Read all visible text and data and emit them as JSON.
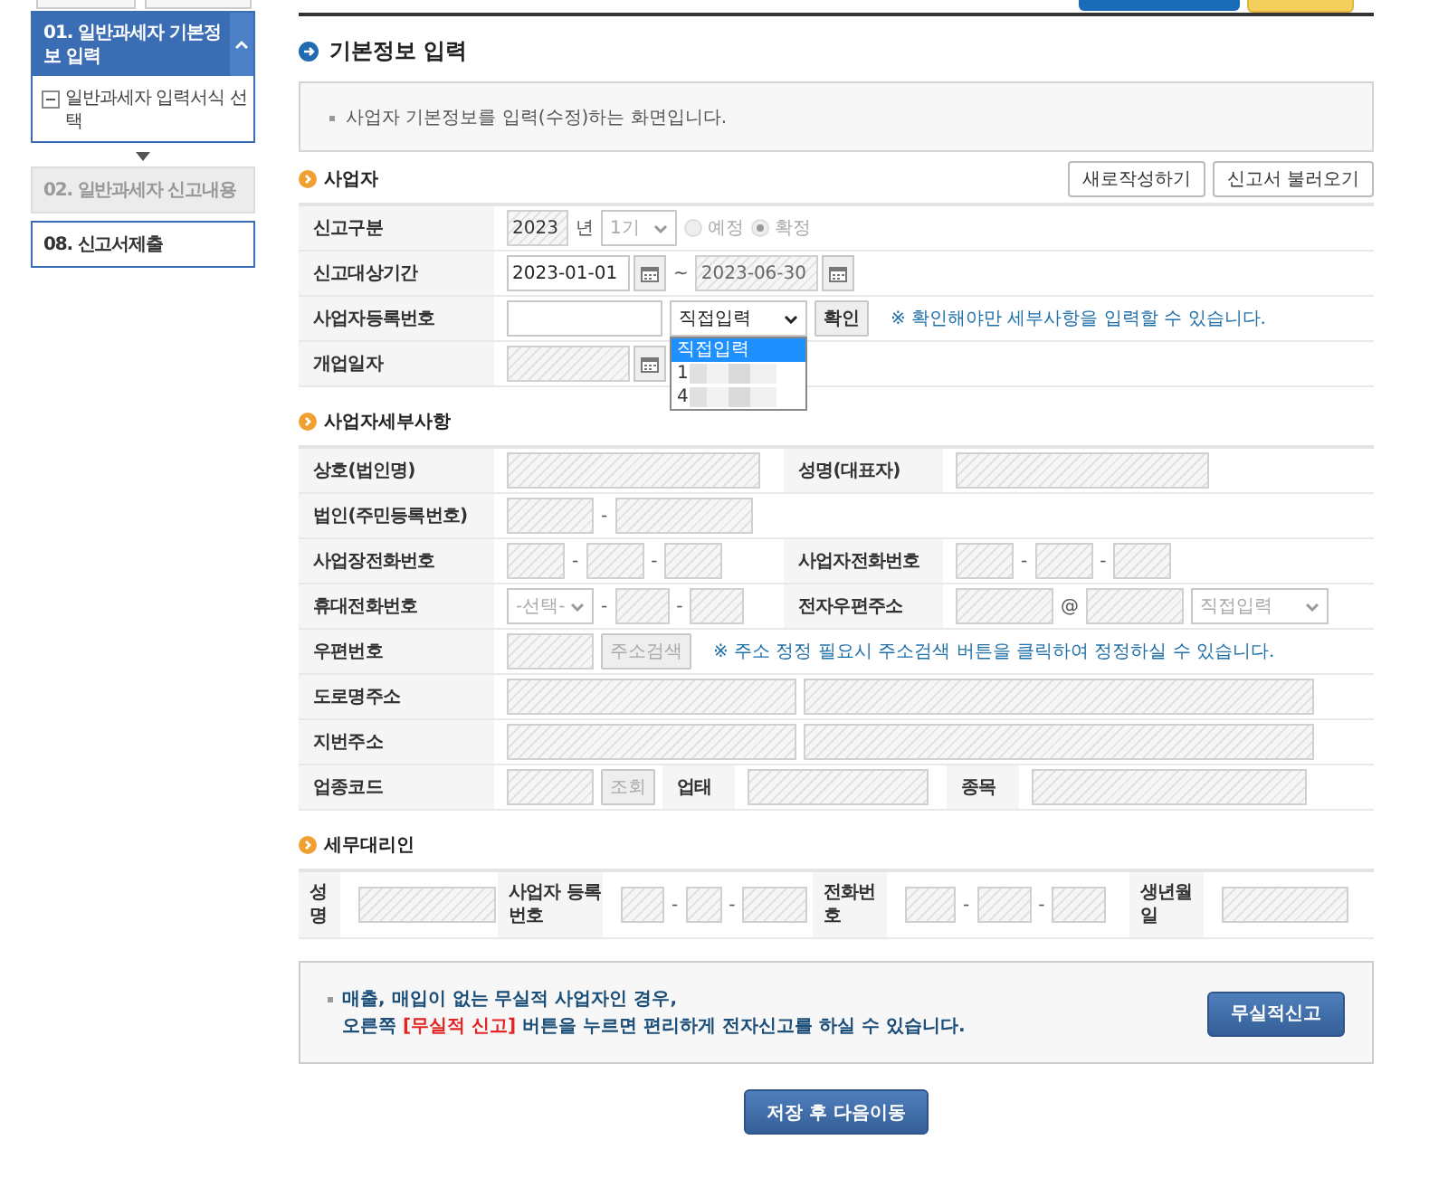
{
  "sidebar": {
    "steps": [
      {
        "label": "01. 일반과세자 기본정보 입력",
        "kind": "current",
        "expanded": true,
        "children": [
          {
            "label": "일반과세자 입력서식 선택"
          }
        ]
      },
      {
        "label": "02. 일반과세자 신고내용",
        "kind": "disabled"
      },
      {
        "label": "08. 신고서제출",
        "kind": "enabled"
      }
    ]
  },
  "page_title": "기본정보 입력",
  "info": "사업자 기본정보를 입력(수정)하는 화면입니다.",
  "sections": [
    {
      "title": "사업자",
      "buttons": [
        "새로작성하기",
        "신고서 불러오기"
      ],
      "rows": [
        {
          "cells": [
            {
              "kind": "label",
              "text": "신고구분"
            },
            {
              "kind": "value",
              "controls": [
                {
                  "kind": "input",
                  "value": "2023",
                  "readonly": true
                },
                {
                  "kind": "text",
                  "text": "년"
                },
                {
                  "kind": "select",
                  "value": "1기",
                  "disabled": true
                },
                {
                  "kind": "radio",
                  "label": "예정",
                  "selected": false,
                  "disabled": true
                },
                {
                  "kind": "radio",
                  "label": "확정",
                  "selected": true,
                  "disabled": true
                }
              ]
            }
          ]
        },
        {
          "cells": [
            {
              "kind": "label",
              "text": "신고대상기간"
            },
            {
              "kind": "value",
              "controls": [
                {
                  "kind": "date",
                  "value": "2023-01-01",
                  "readonly": false
                },
                {
                  "kind": "text",
                  "text": "~"
                },
                {
                  "kind": "date",
                  "value": "2023-06-30",
                  "readonly": true
                }
              ]
            }
          ]
        },
        {
          "cells": [
            {
              "kind": "label",
              "text": "사업자등록번호"
            },
            {
              "kind": "value",
              "controls": [
                {
                  "kind": "input",
                  "readonly": false
                },
                {
                  "kind": "select",
                  "value": "직접입력",
                  "disabled": false,
                  "expanded": true,
                  "options": [
                    {
                      "label": "직접입력",
                      "selected": true
                    },
                    {
                      "label": "1",
                      "selected": false
                    },
                    {
                      "label": "4",
                      "selected": false
                    }
                  ]
                },
                {
                  "kind": "button",
                  "label": "확인",
                  "disabled": false
                },
                {
                  "kind": "hint",
                  "text": "※ 확인해야만 세부사항을 입력할 수 있습니다."
                }
              ]
            }
          ]
        },
        {
          "cells": [
            {
              "kind": "label",
              "text": "개업일자"
            },
            {
              "kind": "value",
              "controls": [
                {
                  "kind": "date",
                  "readonly": true
                }
              ]
            }
          ]
        }
      ]
    },
    {
      "title": "사업자세부사항",
      "rows": [
        {
          "cells": [
            {
              "kind": "label",
              "text": "상호(법인명)"
            },
            {
              "kind": "value",
              "controls": [
                {
                  "kind": "input",
                  "readonly": true
                }
              ]
            },
            {
              "kind": "label",
              "text": "성명(대표자)"
            },
            {
              "kind": "value",
              "controls": [
                {
                  "kind": "input",
                  "readonly": true
                }
              ]
            }
          ]
        },
        {
          "cells": [
            {
              "kind": "label",
              "text": "법인(주민등록번호)"
            },
            {
              "kind": "value",
              "controls": [
                {
                  "kind": "input",
                  "readonly": true
                },
                {
                  "kind": "text",
                  "text": "-"
                },
                {
                  "kind": "input",
                  "readonly": true
                }
              ]
            }
          ]
        },
        {
          "cells": [
            {
              "kind": "label",
              "text": "사업장전화번호"
            },
            {
              "kind": "value",
              "controls": [
                {
                  "kind": "input",
                  "readonly": true
                },
                {
                  "kind": "text",
                  "text": "-"
                },
                {
                  "kind": "input",
                  "readonly": true
                },
                {
                  "kind": "text",
                  "text": "-"
                },
                {
                  "kind": "input",
                  "readonly": true
                }
              ]
            },
            {
              "kind": "label",
              "text": "사업자전화번호"
            },
            {
              "kind": "value",
              "controls": [
                {
                  "kind": "input",
                  "readonly": true
                },
                {
                  "kind": "text",
                  "text": "-"
                },
                {
                  "kind": "input",
                  "readonly": true
                },
                {
                  "kind": "text",
                  "text": "-"
                },
                {
                  "kind": "input",
                  "readonly": true
                }
              ]
            }
          ]
        },
        {
          "cells": [
            {
              "kind": "label",
              "text": "휴대전화번호"
            },
            {
              "kind": "value",
              "controls": [
                {
                  "kind": "select",
                  "value": "-선택-",
                  "disabled": true
                },
                {
                  "kind": "text",
                  "text": "-"
                },
                {
                  "kind": "input",
                  "readonly": true
                },
                {
                  "kind": "text",
                  "text": "-"
                },
                {
                  "kind": "input",
                  "readonly": true
                }
              ]
            },
            {
              "kind": "label",
              "text": "전자우편주소"
            },
            {
              "kind": "value",
              "controls": [
                {
                  "kind": "input",
                  "readonly": true
                },
                {
                  "kind": "text",
                  "text": "@"
                },
                {
                  "kind": "input",
                  "readonly": true
                },
                {
                  "kind": "select",
                  "value": "직접입력",
                  "disabled": true
                }
              ]
            }
          ]
        },
        {
          "cells": [
            {
              "kind": "label",
              "text": "우편번호"
            },
            {
              "kind": "value",
              "controls": [
                {
                  "kind": "input",
                  "readonly": true
                },
                {
                  "kind": "button",
                  "label": "주소검색",
                  "disabled": true
                },
                {
                  "kind": "hint",
                  "text": "※ 주소 정정 필요시 주소검색 버튼을 클릭하여 정정하실 수 있습니다."
                }
              ]
            }
          ]
        },
        {
          "cells": [
            {
              "kind": "label",
              "text": "도로명주소"
            },
            {
              "kind": "value",
              "controls": [
                {
                  "kind": "input",
                  "readonly": true
                },
                {
                  "kind": "input",
                  "readonly": true
                }
              ]
            }
          ]
        },
        {
          "cells": [
            {
              "kind": "label",
              "text": "지번주소"
            },
            {
              "kind": "value",
              "controls": [
                {
                  "kind": "input",
                  "readonly": true
                },
                {
                  "kind": "input",
                  "readonly": true
                }
              ]
            }
          ]
        },
        {
          "cells": [
            {
              "kind": "label",
              "text": "업종코드"
            },
            {
              "kind": "value",
              "controls": [
                {
                  "kind": "input",
                  "readonly": true
                },
                {
                  "kind": "button",
                  "label": "조회",
                  "disabled": true
                }
              ]
            },
            {
              "kind": "label",
              "text": "업태"
            },
            {
              "kind": "value",
              "controls": [
                {
                  "kind": "input",
                  "readonly": true
                }
              ]
            },
            {
              "kind": "label",
              "text": "종목"
            },
            {
              "kind": "value",
              "controls": [
                {
                  "kind": "input",
                  "readonly": true
                }
              ]
            }
          ]
        }
      ]
    },
    {
      "title": "세무대리인",
      "rows": [
        {
          "cells": [
            {
              "kind": "label",
              "text": "성명"
            },
            {
              "kind": "value",
              "controls": [
                {
                  "kind": "input",
                  "readonly": true
                }
              ]
            },
            {
              "kind": "label",
              "text": "사업자 등록번호"
            },
            {
              "kind": "value",
              "controls": [
                {
                  "kind": "input",
                  "readonly": true
                },
                {
                  "kind": "text",
                  "text": "-"
                },
                {
                  "kind": "input",
                  "readonly": true
                },
                {
                  "kind": "text",
                  "text": "-"
                },
                {
                  "kind": "input",
                  "readonly": true
                }
              ]
            },
            {
              "kind": "label",
              "text": "전화번호"
            },
            {
              "kind": "value",
              "controls": [
                {
                  "kind": "input",
                  "readonly": true
                },
                {
                  "kind": "text",
                  "text": "-"
                },
                {
                  "kind": "input",
                  "readonly": true
                },
                {
                  "kind": "text",
                  "text": "-"
                },
                {
                  "kind": "input",
                  "readonly": true
                }
              ]
            },
            {
              "kind": "label",
              "text": "생년월일"
            },
            {
              "kind": "value",
              "controls": [
                {
                  "kind": "input",
                  "readonly": true
                }
              ]
            }
          ]
        }
      ]
    }
  ],
  "notice": {
    "lines": [
      "매출, 매입이 없는 무실적 사업자인 경우,",
      "오른쪽 **[무실적 신고]** 버튼을 누르면 편리하게 전자신고를 하실 수 있습니다."
    ],
    "button": "무실적신고"
  },
  "submit": "저장 후 다음이동"
}
